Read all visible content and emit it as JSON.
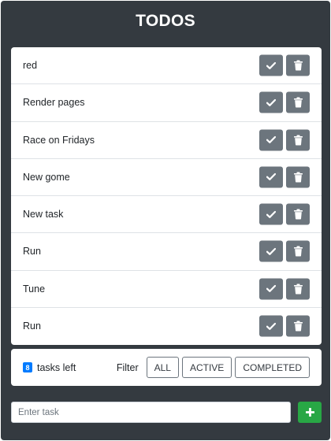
{
  "app": {
    "title": "TODOS"
  },
  "todos": [
    {
      "label": "red"
    },
    {
      "label": "Render pages"
    },
    {
      "label": "Race on Fridays"
    },
    {
      "label": "New gome"
    },
    {
      "label": "New task"
    },
    {
      "label": "Run"
    },
    {
      "label": "Tune"
    },
    {
      "label": "Run"
    }
  ],
  "item_actions": {
    "complete_icon": "check-icon",
    "delete_icon": "trash-icon"
  },
  "footer": {
    "count": "8",
    "tasks_left_label": "tasks left",
    "filter_label": "Filter",
    "filters": [
      "ALL",
      "ACTIVE",
      "COMPLETED"
    ]
  },
  "add_task": {
    "placeholder": "Enter task",
    "value": "",
    "add_icon": "plus-icon"
  },
  "colors": {
    "app_background": "#343a40",
    "action_button": "#6c757d",
    "add_button": "#28a745",
    "count_badge": "#007bff"
  }
}
